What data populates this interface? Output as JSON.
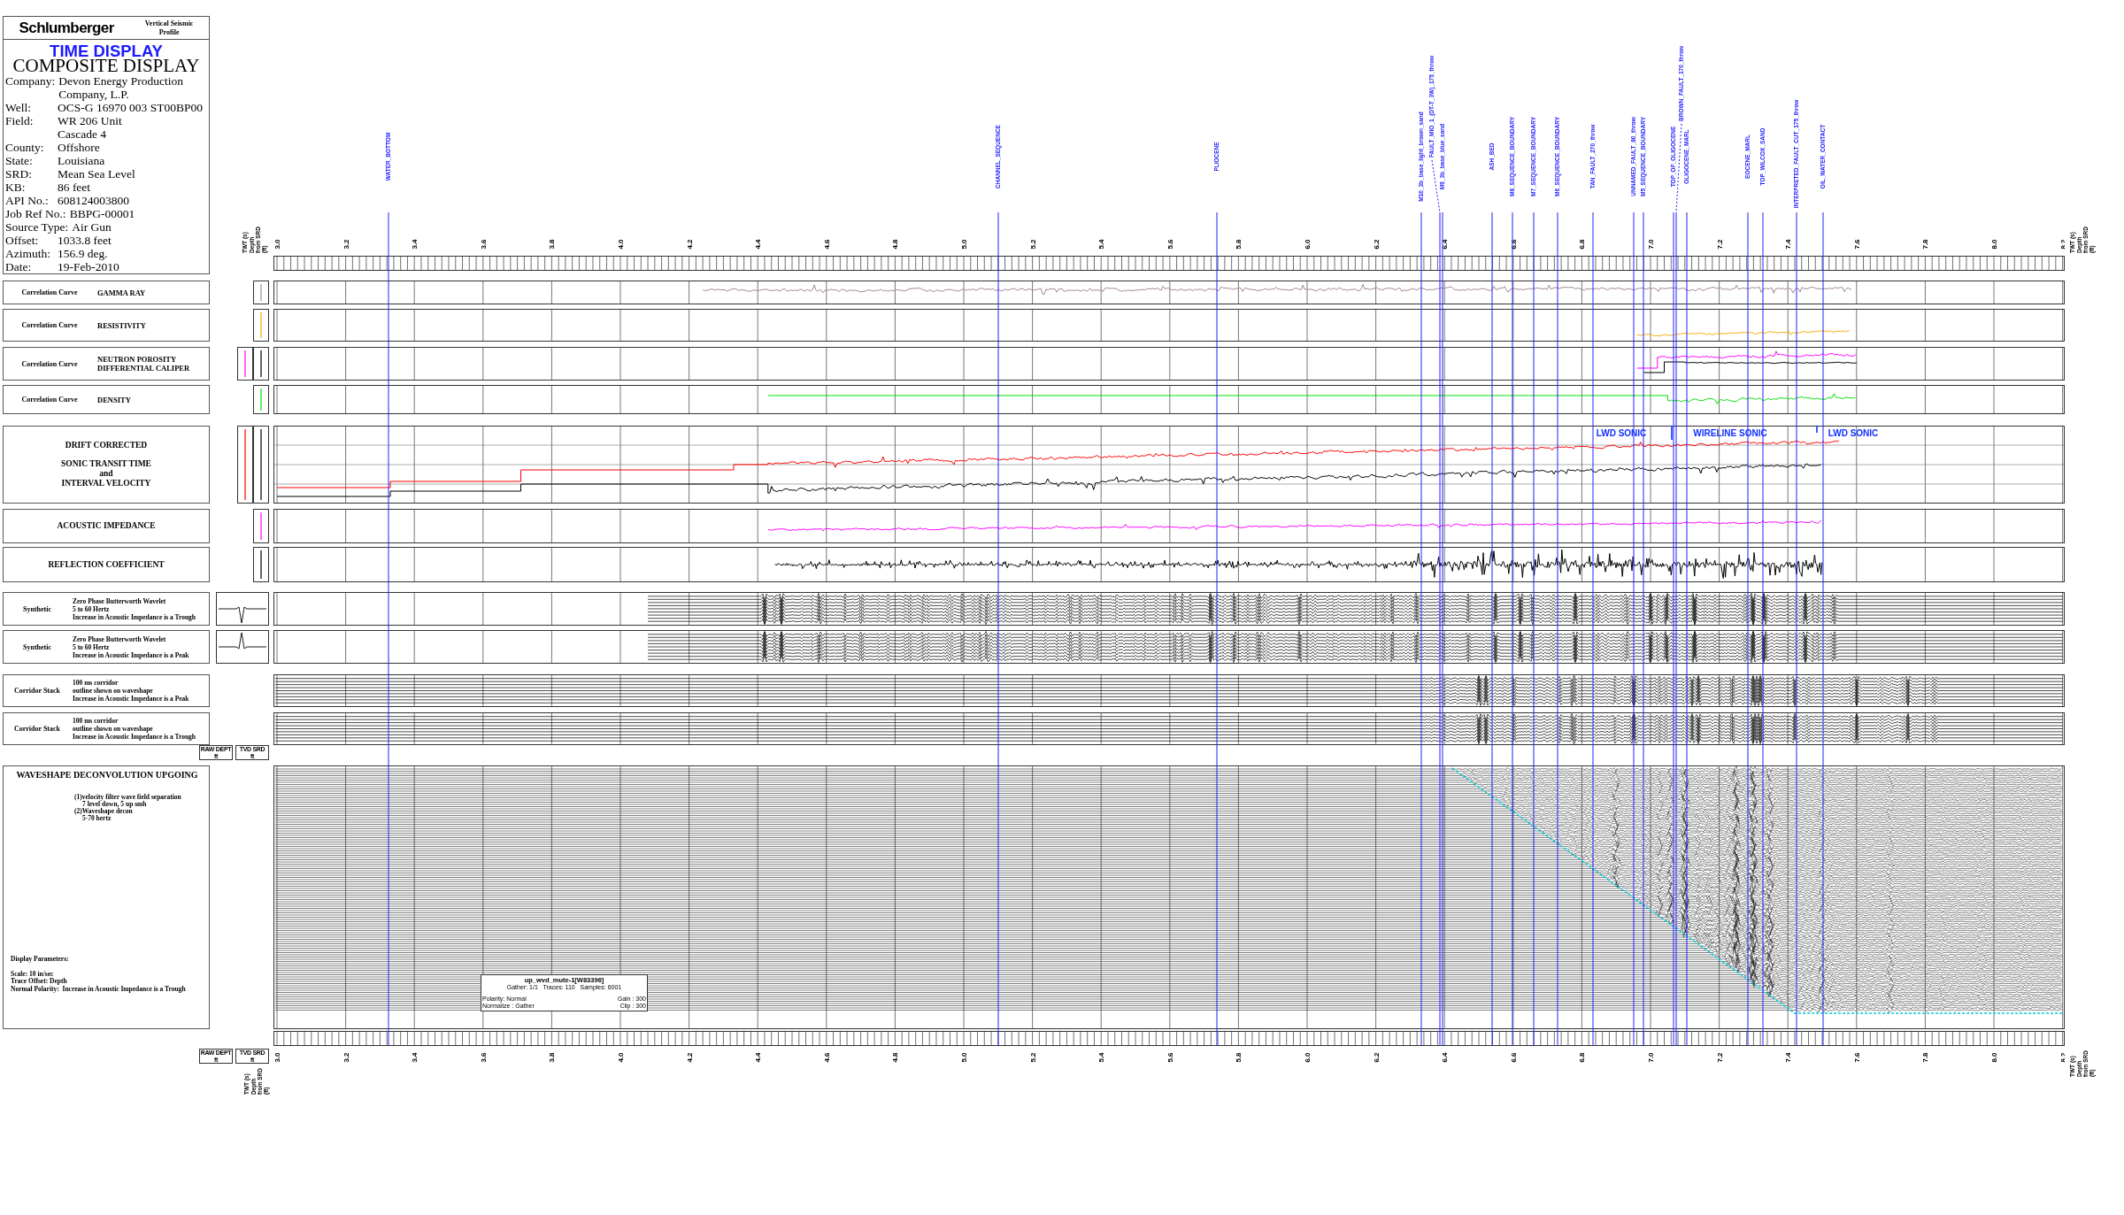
{
  "header": {
    "logo": "Schlumberger",
    "product": [
      "Vertical Seismic",
      "Profile"
    ],
    "title": "TIME DISPLAY",
    "subtitle": "COMPOSITE DISPLAY",
    "fields": [
      {
        "label": "Company:",
        "value_lines": [
          "Devon Energy Production",
          "Company, L.P."
        ]
      },
      {
        "label": "Well:",
        "value_lines": [
          "OCS-G 16970 003 ST00BP00"
        ]
      },
      {
        "label": "Field:",
        "value_lines": [
          "WR 206 Unit",
          "Cascade 4"
        ]
      },
      {
        "label": "County:",
        "value_lines": [
          "Offshore"
        ]
      },
      {
        "label": "State:",
        "value_lines": [
          "Louisiana"
        ]
      },
      {
        "label": "SRD:",
        "value_lines": [
          "Mean Sea Level"
        ]
      },
      {
        "label": "KB:",
        "value_lines": [
          "86 feet"
        ]
      },
      {
        "label": "API No.:",
        "value_lines": [
          "608124003800"
        ]
      },
      {
        "label": "Job Ref No.:",
        "value_lines": [
          "BBPG-00001"
        ]
      },
      {
        "label": "Source Type:",
        "value_lines": [
          "Air Gun"
        ]
      },
      {
        "label": "Offset:",
        "value_lines": [
          "1033.8 feet"
        ]
      },
      {
        "label": "Azimuth:",
        "value_lines": [
          "156.9 deg."
        ]
      },
      {
        "label": "Date:",
        "value_lines": [
          "19-Feb-2010"
        ]
      }
    ]
  },
  "top_axis": {
    "labels": [
      "TWT (s)",
      "Depth from SRD (ft)"
    ],
    "ticks": [
      "3.0",
      "3.2",
      "3.4",
      "3.6",
      "3.8",
      "4.0",
      "4.2",
      "4.4",
      "4.6",
      "4.8",
      "5.0",
      "5.2",
      "5.4",
      "5.6",
      "5.8",
      "6.0",
      "6.2",
      "6.4",
      "6.6",
      "6.8",
      "7.0",
      "7.2",
      "7.4",
      "7.6",
      "7.8",
      "8.0",
      "8.2"
    ],
    "end_labels": [
      "TWT (s)",
      "Depth from SRD (ft)"
    ]
  },
  "markers": [
    {
      "name": "WATER_BOTTOM",
      "leader": false
    },
    {
      "name": "CHANNEL_SEQUENCE",
      "leader": false
    },
    {
      "name": "PLIOCENE",
      "leader": false
    },
    {
      "name": "M10_3b_base_light_brown_sand",
      "leader": false
    },
    {
      "name": "FAULT_MIO_1_(DT-T_3W)_175_throw",
      "leader": true
    },
    {
      "name": "M9_3b_base_blue_sand",
      "leader": false
    },
    {
      "name": "ASH_BED",
      "leader": false
    },
    {
      "name": "M8_SEQUENCE_BOUNDARY",
      "leader": false
    },
    {
      "name": "M7_SEQUENCE_BOUNDARY",
      "leader": false
    },
    {
      "name": "M6_SEQUENCE_BOUNDARY",
      "leader": false
    },
    {
      "name": "TAN_FAULT_270_throw",
      "leader": false
    },
    {
      "name": "UNNAMED_FAULT_80_throw",
      "leader": false
    },
    {
      "name": "M5_SEQUENCE_BOUNDARY",
      "leader": false
    },
    {
      "name": "TOP_OF_OLIGOCENE",
      "leader": false
    },
    {
      "name": "BROWN_FAULT_170_throw",
      "leader": true
    },
    {
      "name": "OLIGOCENE_MARL",
      "leader": false
    },
    {
      "name": "EOCENE_MARL",
      "leader": false
    },
    {
      "name": "TOP_WILCOX_SAND",
      "leader": false
    },
    {
      "name": "INTERPRETED_FAULT_CUT_175_throw",
      "leader": false
    },
    {
      "name": "OIL_WATER_CONTACT",
      "leader": false
    }
  ],
  "tracks": [
    {
      "kind": "log",
      "caption": "Correlation Curve",
      "name_lines": [
        "GAMMA RAY"
      ],
      "curves": [
        {
          "color": "#a08898"
        }
      ]
    },
    {
      "kind": "log",
      "caption": "Correlation Curve",
      "name_lines": [
        "RESISTIVITY"
      ],
      "curves": [
        {
          "color": "#f5a800"
        }
      ]
    },
    {
      "kind": "log",
      "caption": "Correlation Curve",
      "name_lines": [
        "NEUTRON POROSITY",
        "DIFFERENTIAL CALIPER"
      ],
      "curves": [
        {
          "color": "#ff00ff"
        },
        {
          "color": "#000000"
        }
      ]
    },
    {
      "kind": "log",
      "caption": "Correlation Curve",
      "name_lines": [
        "DENSITY"
      ],
      "curves": [
        {
          "color": "#00e000"
        }
      ]
    },
    {
      "kind": "log",
      "heading_lines": [
        "DRIFT CORRECTED",
        "SONIC TRANSIT TIME",
        "and",
        "INTERVAL VELOCITY"
      ],
      "curves": [
        {
          "color": "#ff0000"
        },
        {
          "color": "#000000"
        }
      ],
      "annotations": [
        "LWD SONIC",
        "WIRELINE SONIC",
        "LWD SONIC"
      ]
    },
    {
      "kind": "log",
      "heading_lines": [
        "ACOUSTIC IMPEDANCE"
      ],
      "curves": [
        {
          "color": "#ff00ff"
        }
      ]
    },
    {
      "kind": "log",
      "heading_lines": [
        "REFLECTION COEFFICIENT"
      ],
      "curves": [
        {
          "color": "#000000"
        }
      ]
    },
    {
      "kind": "synthetic",
      "caption": "Synthetic",
      "note_lines": [
        "Zero Phase Butterworth Wavelet",
        "5 to 60 Hertz",
        "Increase in Acoustic Impedance is a Trough"
      ],
      "peak": false
    },
    {
      "kind": "synthetic",
      "caption": "Synthetic",
      "note_lines": [
        "Zero Phase Butterworth Wavelet",
        "5 to 60 Hertz",
        "Increase in Acoustic Impedance is a Peak"
      ],
      "peak": true
    },
    {
      "kind": "corridor",
      "caption": "Corridor Stack",
      "note_lines": [
        "100 ms corridor",
        "outline shown on waveshape",
        "Increase in Acoustic Impedance is a Peak"
      ],
      "peak": true
    },
    {
      "kind": "corridor",
      "caption": "Corridor Stack",
      "note_lines": [
        "100 ms corridor",
        "outline shown on waveshape",
        "Increase in Acoustic Impedance is a Trough"
      ],
      "peak": false
    },
    {
      "kind": "section",
      "depth_columns": [
        {
          "title": "RAW DEPT",
          "unit": "ft"
        },
        {
          "title": "TVD SRD",
          "unit": "ft"
        }
      ],
      "heading_lines": [
        "WAVESHAPE DECONVOLUTION UPGOING"
      ],
      "notes": [
        {
          "text": "(1)velocity filter wave field separation",
          "children": [
            {
              "text": "7 level down, 5 up smh"
            }
          ]
        },
        {
          "text": "(2)Waveshape decon",
          "children": [
            {
              "text": "5-70 hertz"
            }
          ]
        }
      ],
      "parameters": {
        "title": "Display Parameters:",
        "lines": [
          "Scale: 10 in/sec",
          "Trace Offset: Depth",
          "Normal Polarity:  Increase in Acoustic Impedance is a Trough"
        ]
      },
      "info_box": {
        "title": "up_wvd_mute-1[W83396]",
        "summary": "Gather: 1/1   Traces: 110   Samples: 6001",
        "left_lines": [
          "Polarity: Normal",
          "Normalize : Gather"
        ],
        "right_lines": [
          "Gain : 300",
          "Clip : 300"
        ]
      }
    }
  ],
  "bottom_axis": {
    "depth_columns": [
      {
        "title": "RAW DEPT",
        "unit": "ft"
      },
      {
        "title": "TVD SRD",
        "unit": "ft"
      }
    ],
    "ticks": [
      "3.0",
      "3.2",
      "3.4",
      "3.6",
      "3.8",
      "4.0",
      "4.2",
      "4.4",
      "4.6",
      "4.8",
      "5.0",
      "5.2",
      "5.4",
      "5.6",
      "5.8",
      "6.0",
      "6.2",
      "6.4",
      "6.6",
      "6.8",
      "7.0",
      "7.2",
      "7.4",
      "7.6",
      "7.8",
      "8.0",
      "8.2"
    ],
    "labels": [
      "TWT (s)",
      "Depth from SRD (ft)"
    ],
    "end_labels": [
      "TWT (s)",
      "Depth from SRD (ft)"
    ]
  }
}
